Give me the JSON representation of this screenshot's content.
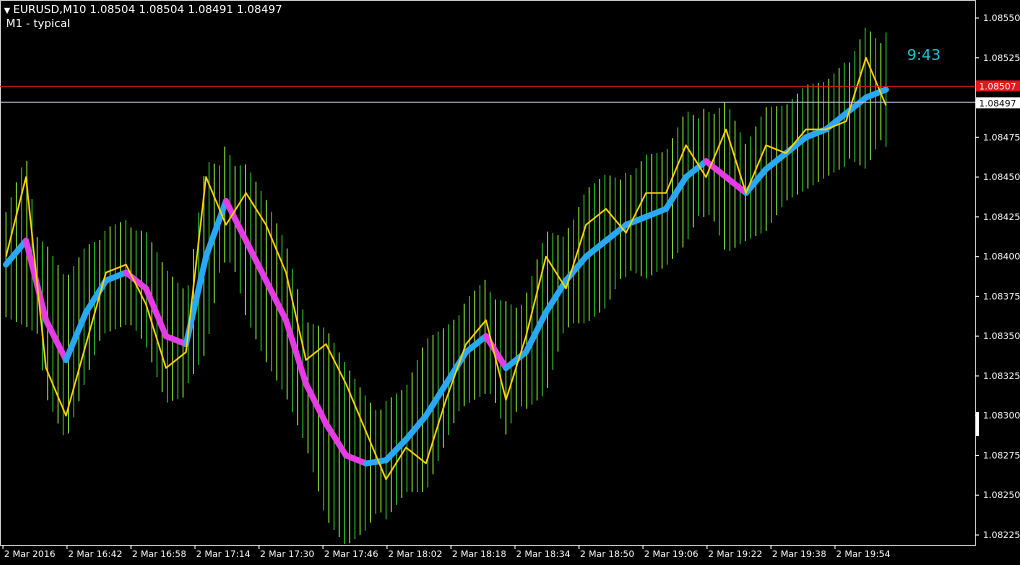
{
  "header": {
    "symbol_line": "EURUSD,M10  1.08504 1.08504 1.08491 1.08497",
    "indicator_name": "M1 - typical"
  },
  "timer": "9:43",
  "colors": {
    "background": "#000000",
    "up_band": "#2fd12f",
    "up_band_fill": "#9dff3a",
    "rising_line": "#29a9f5",
    "falling_line": "#e63ce6",
    "price_line": "#ffd400",
    "ask_line": "#e01818",
    "bid_line": "#b8c4d4",
    "axis": "#ffffff",
    "timer": "#1ec8d6"
  },
  "price_axis": {
    "labels": [
      "1.08550",
      "1.08525",
      "1.08497",
      "1.08475",
      "1.08450",
      "1.08425",
      "1.08400",
      "1.08375",
      "1.08350",
      "1.08325",
      "1.08300",
      "1.08275",
      "1.08250",
      "1.08225"
    ],
    "current_bid": "1.08497",
    "current_ask": "1.08507"
  },
  "time_axis": {
    "labels": [
      "2 Mar 2016",
      "2 Mar 16:42",
      "2 Mar 16:58",
      "2 Mar 17:14",
      "2 Mar 17:30",
      "2 Mar 17:46",
      "2 Mar 18:02",
      "2 Mar 18:18",
      "2 Mar 18:34",
      "2 Mar 18:50",
      "2 Mar 19:06",
      "2 Mar 19:22",
      "2 Mar 19:38",
      "2 Mar 19:54"
    ]
  },
  "chart_data": {
    "type": "line",
    "ylim": [
      1.08225,
      1.0856
    ],
    "series": [
      {
        "values": [
          1.084,
          1.0845,
          1.0833,
          1.083,
          1.08345,
          1.0839,
          1.08395,
          1.0837,
          1.0833,
          1.0834,
          1.0845,
          1.0842,
          1.0844,
          1.0842,
          1.0839,
          1.08335,
          1.08345,
          1.0832,
          1.0829,
          1.0826,
          1.0828,
          1.0827,
          1.0831,
          1.08345,
          1.0836,
          1.0831,
          1.0835,
          1.084,
          1.0838,
          1.0842,
          1.0843,
          1.08415,
          1.0844,
          1.0844,
          1.0847,
          1.0845,
          1.0848,
          1.0844,
          1.0847,
          1.08465,
          1.0848,
          1.0848,
          1.08485,
          1.08525,
          1.08495
        ]
      },
      {
        "values": [
          1.08395,
          1.0841,
          1.0836,
          1.08335,
          1.08365,
          1.08385,
          1.0839,
          1.0838,
          1.0835,
          1.08345,
          1.084,
          1.08435,
          1.0841,
          1.08385,
          1.0836,
          1.0832,
          1.08295,
          1.08275,
          1.0827,
          1.08272,
          1.08285,
          1.083,
          1.0832,
          1.0834,
          1.0835,
          1.0833,
          1.0834,
          1.08365,
          1.08385,
          1.084,
          1.0841,
          1.0842,
          1.08425,
          1.0843,
          1.0845,
          1.0846,
          1.0845,
          1.0844,
          1.08455,
          1.08465,
          1.08475,
          1.0848,
          1.0849,
          1.085,
          1.08505
        ]
      }
    ]
  }
}
